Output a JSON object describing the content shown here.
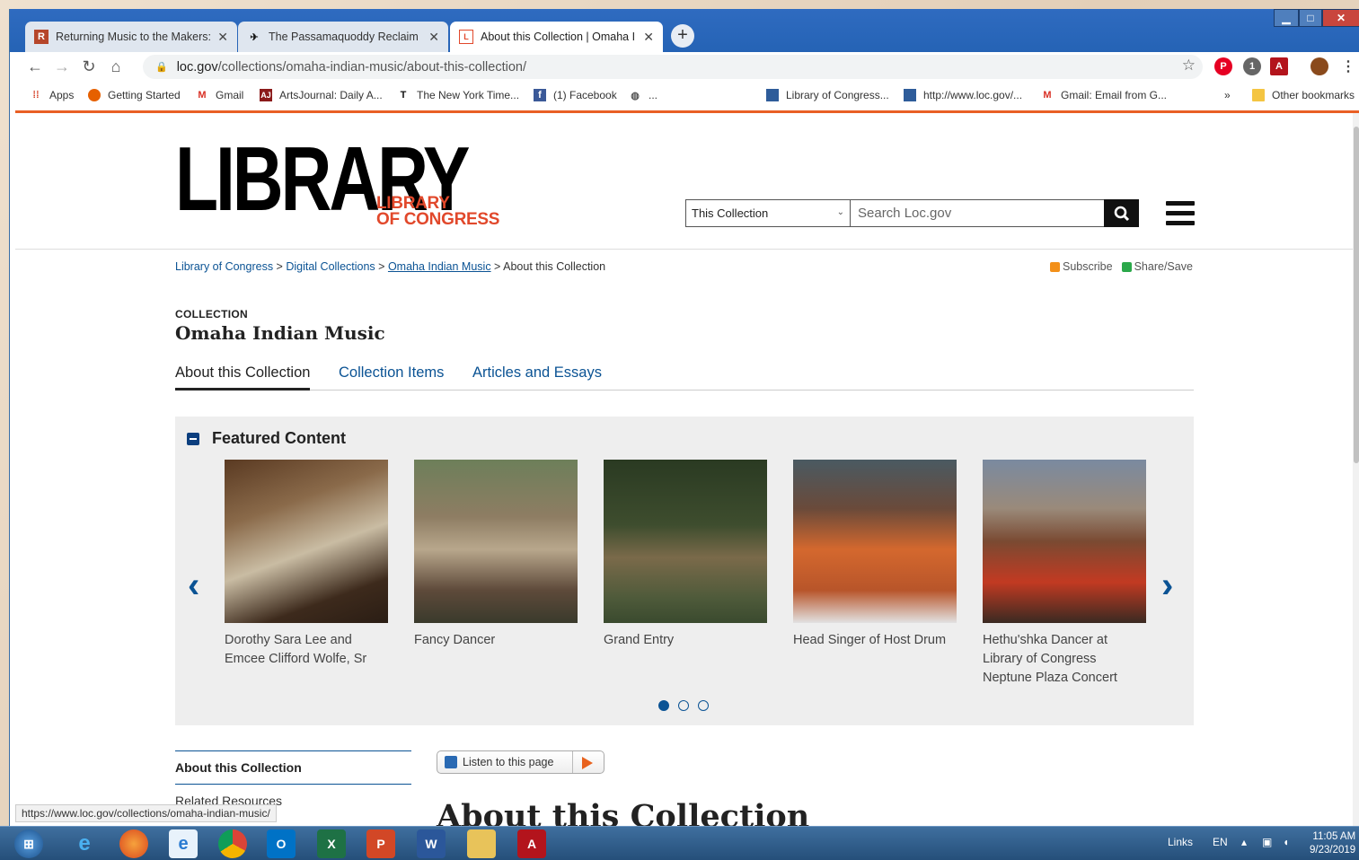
{
  "browser": {
    "tabs": [
      {
        "title": "Returning Music to the Makers: T",
        "icon": "r-icon"
      },
      {
        "title": "The Passamaquoddy Reclaim The",
        "icon": "pin-icon"
      },
      {
        "title": "About this Collection | Omaha Ir",
        "icon": "loc-icon"
      }
    ],
    "new_tab": "+",
    "url_domain": "loc.gov",
    "url_path": "/collections/omaha-indian-music/about-this-collection/",
    "ext_badge": "1",
    "bookmarks": [
      {
        "label": "Apps"
      },
      {
        "label": "Getting Started"
      },
      {
        "label": "Gmail"
      },
      {
        "label": "ArtsJournal: Daily A..."
      },
      {
        "label": "The New York Time..."
      },
      {
        "label": "(1) Facebook"
      },
      {
        "label": "..."
      },
      {
        "label": "Library of Congress..."
      },
      {
        "label": "http://www.loc.gov/..."
      },
      {
        "label": "Gmail: Email from G..."
      },
      {
        "label": "»"
      },
      {
        "label": "Other bookmarks"
      }
    ],
    "status_url": "https://www.loc.gov/collections/omaha-indian-music/"
  },
  "header": {
    "logo_big": "LIBRARY",
    "logo_line1": "LIBRARY",
    "logo_line2": "OF CONGRESS",
    "scope_select": "This Collection",
    "search_placeholder": "Search Loc.gov"
  },
  "breadcrumb": {
    "items": [
      "Library of Congress",
      "Digital Collections",
      "Omaha Indian Music",
      "About this Collection"
    ],
    "sep": " > "
  },
  "share": {
    "subscribe": "Subscribe",
    "share_save": "Share/Save"
  },
  "collection": {
    "label": "COLLECTION",
    "title": "Omaha Indian Music"
  },
  "page_tabs": [
    "About this Collection",
    "Collection Items",
    "Articles and Essays"
  ],
  "featured": {
    "heading": "Featured Content",
    "items": [
      {
        "caption": "Dorothy Sara Lee and Emcee Clifford Wolfe, Sr"
      },
      {
        "caption": "Fancy Dancer"
      },
      {
        "caption": "Grand Entry"
      },
      {
        "caption": "Head Singer of Host Drum"
      },
      {
        "caption": "Hethu'shka Dancer at Library of Congress Neptune Plaza Concert"
      }
    ],
    "prev": "‹",
    "next": "›"
  },
  "sidenav": [
    "About this Collection",
    "Related Resources"
  ],
  "listen_label": "Listen to this page",
  "main_heading": "About this Collection",
  "taskbar": {
    "links": "Links",
    "lang": "EN",
    "time": "11:05 AM",
    "date": "9/23/2019"
  }
}
